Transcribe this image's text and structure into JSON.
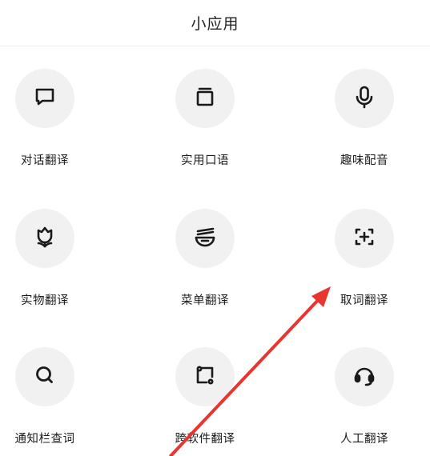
{
  "header": {
    "title": "小应用"
  },
  "apps": [
    {
      "label": "对话翻译",
      "icon": "chat-bubble-icon"
    },
    {
      "label": "实用口语",
      "icon": "cards-stack-icon"
    },
    {
      "label": "趣味配音",
      "icon": "microphone-icon"
    },
    {
      "label": "实物翻译",
      "icon": "flower-icon"
    },
    {
      "label": "菜单翻译",
      "icon": "noodle-bowl-icon"
    },
    {
      "label": "取词翻译",
      "icon": "scan-plus-icon"
    },
    {
      "label": "通知栏查词",
      "icon": "search-icon"
    },
    {
      "label": "跨软件翻译",
      "icon": "cross-app-icon"
    },
    {
      "label": "人工翻译",
      "icon": "headset-icon"
    }
  ],
  "colors": {
    "icon_bg": "#f1f1f1",
    "icon_stroke": "#1a1a1a",
    "arrow": "#e8352f"
  }
}
